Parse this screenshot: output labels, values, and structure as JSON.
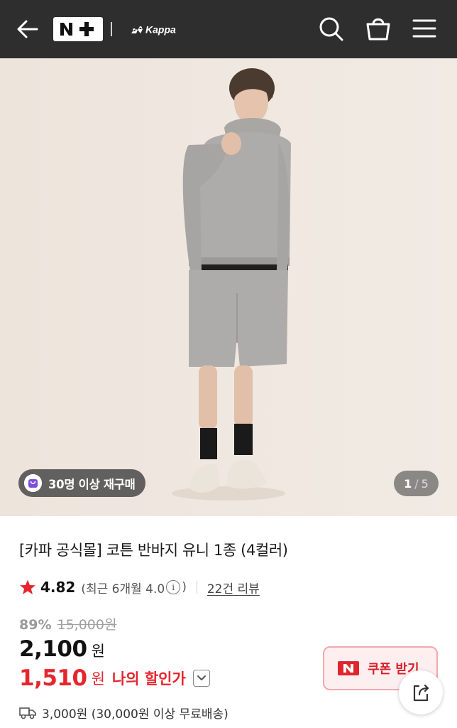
{
  "header": {
    "back_icon": "arrow-left-icon",
    "brand_badge": "N+",
    "brand_logo": "Kappa",
    "search_icon": "search-icon",
    "cart_icon": "shopping-bag-icon",
    "menu_icon": "hamburger-menu-icon",
    "background": "#2e2e2e"
  },
  "gallery": {
    "repurchase_badge": "30명 이상 재구매",
    "current_page": "1",
    "total_pages": "5",
    "separator": "/",
    "background": "#efe7df"
  },
  "product": {
    "title": "[카파 공식몰] 코튼 반바지 유니 1종 (4컬러)",
    "rating": "4.82",
    "rating_recent_prefix": "(최근 6개월 4.0",
    "rating_recent_suffix": ")",
    "review_link": "22건 리뷰",
    "discount_rate": "89%",
    "original_price": "15,000원",
    "sale_price": "2,100",
    "sale_unit": "원",
    "my_price": "1,510",
    "my_unit": "원",
    "my_price_label": "나의 할인가",
    "shipping": "3,000원 (30,000원 이상 무료배송)"
  },
  "coupon": {
    "label": "쿠폰 받기"
  },
  "colors": {
    "accent_red": "#e5262e",
    "coupon_bg": "#fdeff0"
  }
}
